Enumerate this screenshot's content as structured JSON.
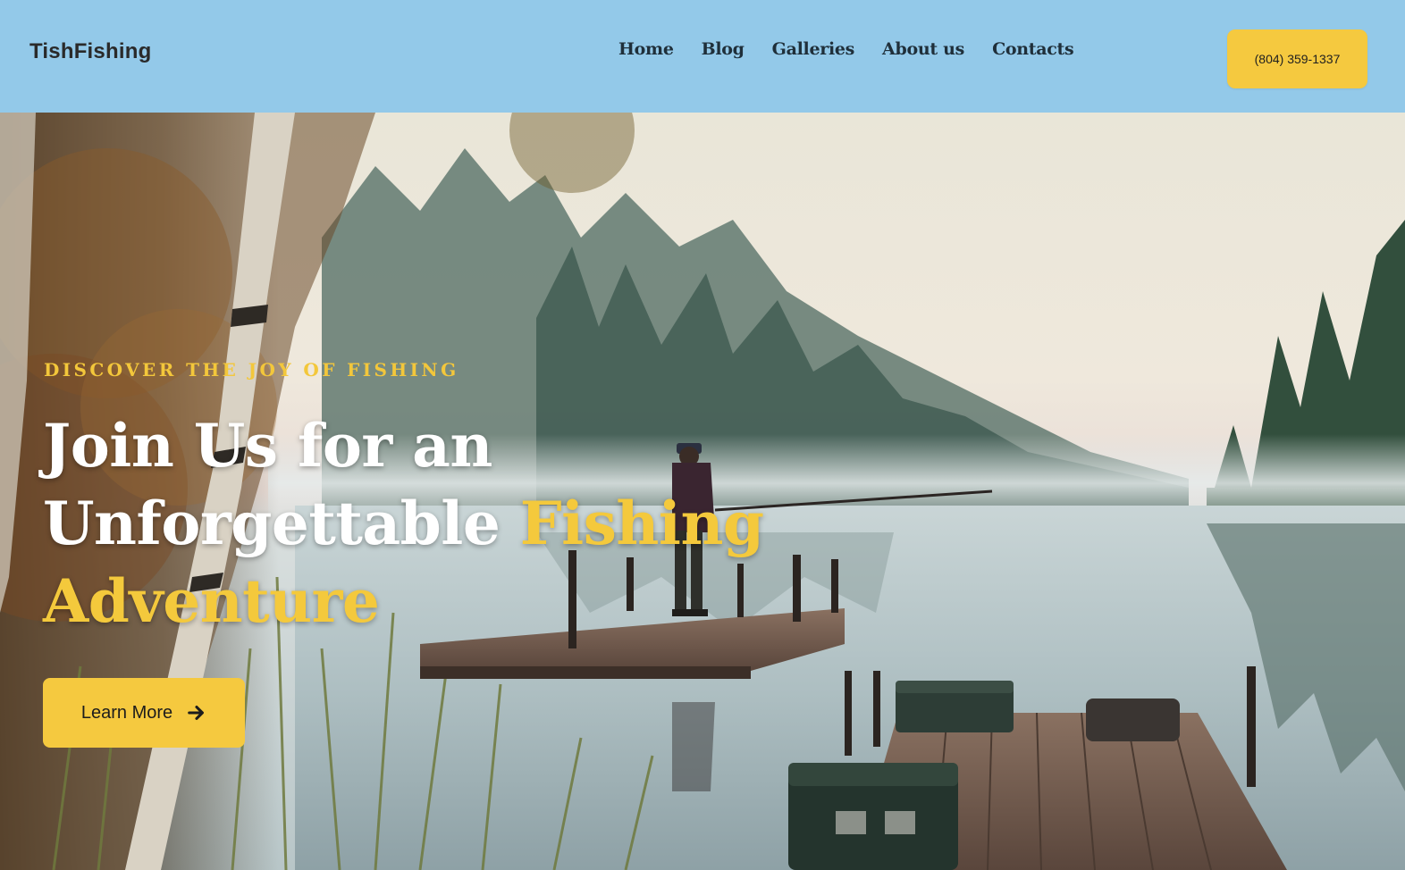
{
  "header": {
    "logo": "TishFishing",
    "nav": [
      "Home",
      "Blog",
      "Galleries",
      "About us",
      "Contacts"
    ],
    "phone": "(804) 359-1337"
  },
  "hero": {
    "eyebrow": "DISCOVER THE JOY OF FISHING",
    "headline_line1": "Join Us for an",
    "headline_line2_white": "Unforgettable ",
    "headline_line2_accent": "Fishing",
    "headline_line3_accent": "Adventure",
    "cta_label": "Learn More",
    "cta_icon": "arrow-right-icon",
    "background_image": "fisherman-on-dock-misty-lake"
  },
  "colors": {
    "header_bg": "#93c9e9",
    "accent": "#f5c93f",
    "text_dark": "#1f2f3a"
  }
}
